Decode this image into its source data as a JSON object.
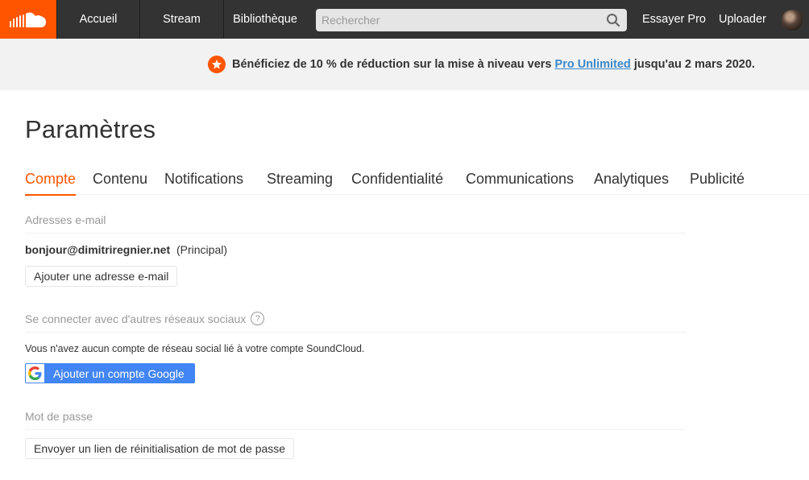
{
  "nav": {
    "home": "Accueil",
    "stream": "Stream",
    "library": "Bibliothèque",
    "search_placeholder": "Rechercher",
    "try_pro": "Essayer Pro",
    "upload": "Uploader"
  },
  "banner": {
    "text_before": "Bénéficiez de 10 % de réduction sur la mise à niveau vers ",
    "link": "Pro Unlimited",
    "text_after": " jusqu'au 2 mars 2020."
  },
  "page": {
    "title": "Paramètres"
  },
  "tabs": [
    {
      "label": "Compte",
      "active": true
    },
    {
      "label": "Contenu"
    },
    {
      "label": "Notifications"
    },
    {
      "label": "Streaming"
    },
    {
      "label": "Confidentialité"
    },
    {
      "label": "Communications"
    },
    {
      "label": "Analytiques"
    },
    {
      "label": "Publicité"
    }
  ],
  "email_section": {
    "title": "Adresses e-mail",
    "address": "bonjour@dimitriregnier.net",
    "primary_tag": "(Principal)",
    "add_button": "Ajouter une adresse e-mail"
  },
  "social_section": {
    "title": "Se connecter avec d'autres réseaux sociaux",
    "description": "Vous n'avez aucun compte de réseau social lié à votre compte SoundCloud.",
    "google_button": "Ajouter un compte Google"
  },
  "password_section": {
    "title": "Mot de passe",
    "reset_button": "Envoyer un lien de réinitialisation de mot de passe"
  },
  "colors": {
    "brand": "#ff5500",
    "topbar": "#333333",
    "link": "#3a87c9",
    "google": "#4285f4"
  },
  "icons": {
    "logo": "soundcloud-cloud-icon",
    "search": "magnifier-icon",
    "promo": "star-icon",
    "help": "question-icon",
    "google": "google-g-icon"
  }
}
